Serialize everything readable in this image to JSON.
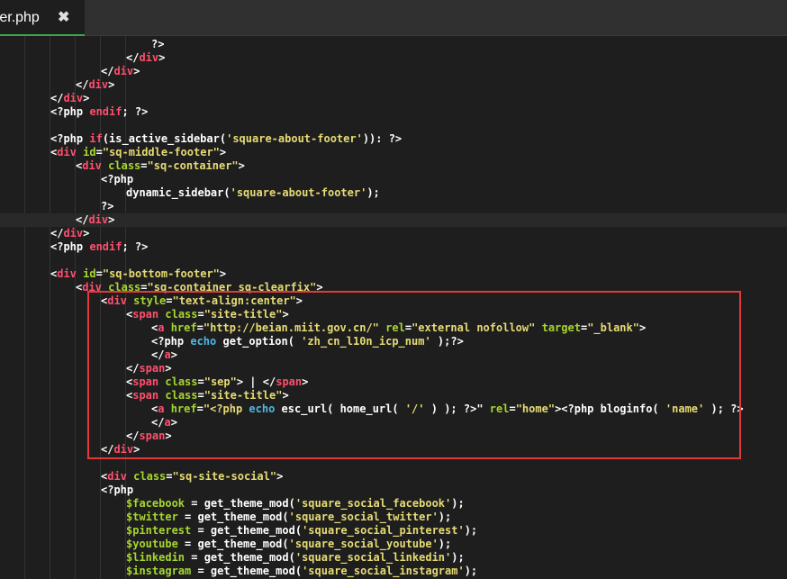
{
  "tab": {
    "title": "oter.php",
    "close_icon": "close-icon"
  },
  "colors": {
    "background": "#1e1e1e",
    "tag": "#ff4f6d",
    "attribute": "#a6d62e",
    "string": "#e6db74",
    "keyword": "#ff4f6d",
    "variable": "#a6d62e",
    "echo": "#4fb8de",
    "plain": "#ffffff",
    "active_tab_underline": "#3fa34d",
    "annotation_box": "#e23a3a"
  },
  "code": [
    {
      "indent": 6,
      "tokens": [
        [
          "?>",
          "ph"
        ]
      ]
    },
    {
      "indent": 5,
      "tokens": [
        [
          "</",
          "pl"
        ],
        [
          "div",
          "tag"
        ],
        [
          ">",
          "pl"
        ]
      ]
    },
    {
      "indent": 4,
      "tokens": [
        [
          "</",
          "pl"
        ],
        [
          "div",
          "tag"
        ],
        [
          ">",
          "pl"
        ]
      ]
    },
    {
      "indent": 3,
      "tokens": [
        [
          "</",
          "pl"
        ],
        [
          "div",
          "tag"
        ],
        [
          ">",
          "pl"
        ]
      ]
    },
    {
      "indent": 2,
      "tokens": [
        [
          "</",
          "pl"
        ],
        [
          "div",
          "tag"
        ],
        [
          ">",
          "pl"
        ]
      ]
    },
    {
      "indent": 2,
      "tokens": [
        [
          "<?php ",
          "ph"
        ],
        [
          "endif",
          "key"
        ],
        [
          "; ?>",
          "ph"
        ]
      ]
    },
    {
      "indent": 0,
      "tokens": []
    },
    {
      "indent": 2,
      "tokens": [
        [
          "<?php ",
          "ph"
        ],
        [
          "if",
          "key"
        ],
        [
          "(is_active_sidebar(",
          "pl"
        ],
        [
          "'square-about-footer'",
          "str"
        ],
        [
          ")): ?>",
          "pl"
        ]
      ]
    },
    {
      "indent": 2,
      "tokens": [
        [
          "<",
          "pl"
        ],
        [
          "div",
          "tag"
        ],
        [
          " ",
          "pl"
        ],
        [
          "id",
          "attr"
        ],
        [
          "=",
          "pl"
        ],
        [
          "\"sq-middle-footer\"",
          "str"
        ],
        [
          ">",
          "pl"
        ]
      ]
    },
    {
      "indent": 3,
      "tokens": [
        [
          "<",
          "pl"
        ],
        [
          "div",
          "tag"
        ],
        [
          " ",
          "pl"
        ],
        [
          "class",
          "attr"
        ],
        [
          "=",
          "pl"
        ],
        [
          "\"sq-container\"",
          "str"
        ],
        [
          ">",
          "pl"
        ]
      ]
    },
    {
      "indent": 4,
      "tokens": [
        [
          "<?php",
          "ph"
        ]
      ]
    },
    {
      "indent": 5,
      "tokens": [
        [
          "dynamic_sidebar(",
          "pl"
        ],
        [
          "'square-about-footer'",
          "str"
        ],
        [
          ");",
          "pl"
        ]
      ]
    },
    {
      "indent": 4,
      "tokens": [
        [
          "?>",
          "ph"
        ]
      ]
    },
    {
      "indent": 3,
      "active": true,
      "tokens": [
        [
          "</",
          "pl"
        ],
        [
          "div",
          "tag"
        ],
        [
          ">",
          "pl"
        ]
      ]
    },
    {
      "indent": 2,
      "tokens": [
        [
          "</",
          "pl"
        ],
        [
          "div",
          "tag"
        ],
        [
          ">",
          "pl"
        ]
      ]
    },
    {
      "indent": 2,
      "tokens": [
        [
          "<?php ",
          "ph"
        ],
        [
          "endif",
          "key"
        ],
        [
          "; ?>",
          "ph"
        ]
      ]
    },
    {
      "indent": 0,
      "tokens": []
    },
    {
      "indent": 2,
      "tokens": [
        [
          "<",
          "pl"
        ],
        [
          "div",
          "tag"
        ],
        [
          " ",
          "pl"
        ],
        [
          "id",
          "attr"
        ],
        [
          "=",
          "pl"
        ],
        [
          "\"sq-bottom-footer\"",
          "str"
        ],
        [
          ">",
          "pl"
        ]
      ]
    },
    {
      "indent": 3,
      "tokens": [
        [
          "<",
          "pl"
        ],
        [
          "div",
          "tag"
        ],
        [
          " ",
          "pl"
        ],
        [
          "class",
          "attr"
        ],
        [
          "=",
          "pl"
        ],
        [
          "\"sq-container sq-clearfix\"",
          "str"
        ],
        [
          ">",
          "pl"
        ]
      ]
    },
    {
      "indent": 4,
      "tokens": [
        [
          "<",
          "pl"
        ],
        [
          "div",
          "tag"
        ],
        [
          " ",
          "pl"
        ],
        [
          "style",
          "attr"
        ],
        [
          "=",
          "pl"
        ],
        [
          "\"text-align:center\"",
          "str"
        ],
        [
          ">",
          "pl"
        ]
      ]
    },
    {
      "indent": 5,
      "tokens": [
        [
          "<",
          "pl"
        ],
        [
          "span",
          "tag"
        ],
        [
          " ",
          "pl"
        ],
        [
          "class",
          "attr"
        ],
        [
          "=",
          "pl"
        ],
        [
          "\"site-title\"",
          "str"
        ],
        [
          ">",
          "pl"
        ]
      ]
    },
    {
      "indent": 6,
      "tokens": [
        [
          "<",
          "pl"
        ],
        [
          "a",
          "tag"
        ],
        [
          " ",
          "pl"
        ],
        [
          "href",
          "attr"
        ],
        [
          "=",
          "pl"
        ],
        [
          "\"http://beian.miit.gov.cn/\"",
          "str"
        ],
        [
          " ",
          "pl"
        ],
        [
          "rel",
          "attr"
        ],
        [
          "=",
          "pl"
        ],
        [
          "\"external nofollow\"",
          "str"
        ],
        [
          " ",
          "pl"
        ],
        [
          "target",
          "attr"
        ],
        [
          "=",
          "pl"
        ],
        [
          "\"_blank\"",
          "str"
        ],
        [
          ">",
          "pl"
        ]
      ]
    },
    {
      "indent": 6,
      "tokens": [
        [
          "<?php ",
          "ph"
        ],
        [
          "echo",
          "ec"
        ],
        [
          " get_option( ",
          "pl"
        ],
        [
          "'zh_cn_l10n_icp_num'",
          "str"
        ],
        [
          " );?>",
          "pl"
        ]
      ]
    },
    {
      "indent": 6,
      "tokens": [
        [
          "</",
          "pl"
        ],
        [
          "a",
          "tag"
        ],
        [
          ">",
          "pl"
        ]
      ]
    },
    {
      "indent": 5,
      "tokens": [
        [
          "</",
          "pl"
        ],
        [
          "span",
          "tag"
        ],
        [
          ">",
          "pl"
        ]
      ]
    },
    {
      "indent": 5,
      "tokens": [
        [
          "<",
          "pl"
        ],
        [
          "span",
          "tag"
        ],
        [
          " ",
          "pl"
        ],
        [
          "class",
          "attr"
        ],
        [
          "=",
          "pl"
        ],
        [
          "\"sep\"",
          "str"
        ],
        [
          "> | </",
          "pl"
        ],
        [
          "span",
          "tag"
        ],
        [
          ">",
          "pl"
        ]
      ]
    },
    {
      "indent": 5,
      "tokens": [
        [
          "<",
          "pl"
        ],
        [
          "span",
          "tag"
        ],
        [
          " ",
          "pl"
        ],
        [
          "class",
          "attr"
        ],
        [
          "=",
          "pl"
        ],
        [
          "\"site-title\"",
          "str"
        ],
        [
          ">",
          "pl"
        ]
      ]
    },
    {
      "indent": 6,
      "tokens": [
        [
          "<",
          "pl"
        ],
        [
          "a",
          "tag"
        ],
        [
          " ",
          "pl"
        ],
        [
          "href",
          "attr"
        ],
        [
          "=",
          "pl"
        ],
        [
          "\"<?php ",
          "str"
        ],
        [
          "echo",
          "ec"
        ],
        [
          " esc_url( home_url( ",
          "pl"
        ],
        [
          "'/'",
          "str"
        ],
        [
          " ) ); ?>\"",
          "pl"
        ],
        [
          " ",
          "pl"
        ],
        [
          "rel",
          "attr"
        ],
        [
          "=",
          "pl"
        ],
        [
          "\"home\"",
          "str"
        ],
        [
          "><?php bloginfo( ",
          "pl"
        ],
        [
          "'name'",
          "str"
        ],
        [
          " ); ?>",
          "pl"
        ]
      ]
    },
    {
      "indent": 6,
      "tokens": [
        [
          "</",
          "pl"
        ],
        [
          "a",
          "tag"
        ],
        [
          ">",
          "pl"
        ]
      ]
    },
    {
      "indent": 5,
      "tokens": [
        [
          "</",
          "pl"
        ],
        [
          "span",
          "tag"
        ],
        [
          ">",
          "pl"
        ]
      ]
    },
    {
      "indent": 4,
      "tokens": [
        [
          "</",
          "pl"
        ],
        [
          "div",
          "tag"
        ],
        [
          ">",
          "pl"
        ]
      ]
    },
    {
      "indent": 0,
      "tokens": []
    },
    {
      "indent": 4,
      "tokens": [
        [
          "<",
          "pl"
        ],
        [
          "div",
          "tag"
        ],
        [
          " ",
          "pl"
        ],
        [
          "class",
          "attr"
        ],
        [
          "=",
          "pl"
        ],
        [
          "\"sq-site-social\"",
          "str"
        ],
        [
          ">",
          "pl"
        ]
      ]
    },
    {
      "indent": 4,
      "tokens": [
        [
          "<?php",
          "ph"
        ]
      ]
    },
    {
      "indent": 5,
      "tokens": [
        [
          "$facebook",
          "var"
        ],
        [
          " = get_theme_mod(",
          "pl"
        ],
        [
          "'square_social_facebook'",
          "str"
        ],
        [
          ");",
          "pl"
        ]
      ]
    },
    {
      "indent": 5,
      "tokens": [
        [
          "$twitter",
          "var"
        ],
        [
          " = get_theme_mod(",
          "pl"
        ],
        [
          "'square_social_twitter'",
          "str"
        ],
        [
          ");",
          "pl"
        ]
      ]
    },
    {
      "indent": 5,
      "tokens": [
        [
          "$pinterest",
          "var"
        ],
        [
          " = get_theme_mod(",
          "pl"
        ],
        [
          "'square_social_pinterest'",
          "str"
        ],
        [
          ");",
          "pl"
        ]
      ]
    },
    {
      "indent": 5,
      "tokens": [
        [
          "$youtube",
          "var"
        ],
        [
          " = get_theme_mod(",
          "pl"
        ],
        [
          "'square_social_youtube'",
          "str"
        ],
        [
          ");",
          "pl"
        ]
      ]
    },
    {
      "indent": 5,
      "tokens": [
        [
          "$linkedin",
          "var"
        ],
        [
          " = get_theme_mod(",
          "pl"
        ],
        [
          "'square_social_linkedin'",
          "str"
        ],
        [
          ");",
          "pl"
        ]
      ]
    },
    {
      "indent": 5,
      "tokens": [
        [
          "$instagram",
          "var"
        ],
        [
          " = get_theme_mod(",
          "pl"
        ],
        [
          "'square_social_instagram'",
          "str"
        ],
        [
          ");",
          "pl"
        ]
      ]
    }
  ]
}
